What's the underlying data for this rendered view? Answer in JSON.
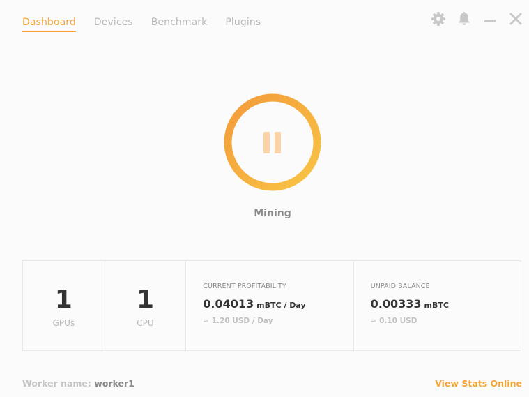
{
  "tabs": [
    {
      "label": "Dashboard",
      "active": true
    },
    {
      "label": "Devices",
      "active": false
    },
    {
      "label": "Benchmark",
      "active": false
    },
    {
      "label": "Plugins",
      "active": false
    }
  ],
  "window_controls": {
    "icons": [
      "gear-icon",
      "bell-icon",
      "minimize-icon",
      "close-icon"
    ]
  },
  "mining": {
    "status_label": "Mining",
    "button_icon": "pause-icon"
  },
  "stats": {
    "gpus": {
      "count": "1",
      "label": "GPUs"
    },
    "cpu": {
      "count": "1",
      "label": "CPU"
    },
    "profitability": {
      "label": "CURRENT PROFITABILITY",
      "value": "0.04013",
      "unit": "mBTC / Day",
      "fiat": "≈ 1.20 USD / Day"
    },
    "balance": {
      "label": "UNPAID BALANCE",
      "value": "0.00333",
      "unit": "mBTC",
      "fiat": "≈ 0.10 USD"
    }
  },
  "footer": {
    "worker_label": "Worker name:",
    "worker_name": "worker1",
    "view_stats": "View Stats Online"
  },
  "colors": {
    "accent": "#f4a535",
    "ring_start": "#f39a3a",
    "ring_end": "#f8c545",
    "pause_bars": "#fcd3a6",
    "muted_text": "#b8b8b8",
    "icon_gray": "#c8c8c8"
  }
}
